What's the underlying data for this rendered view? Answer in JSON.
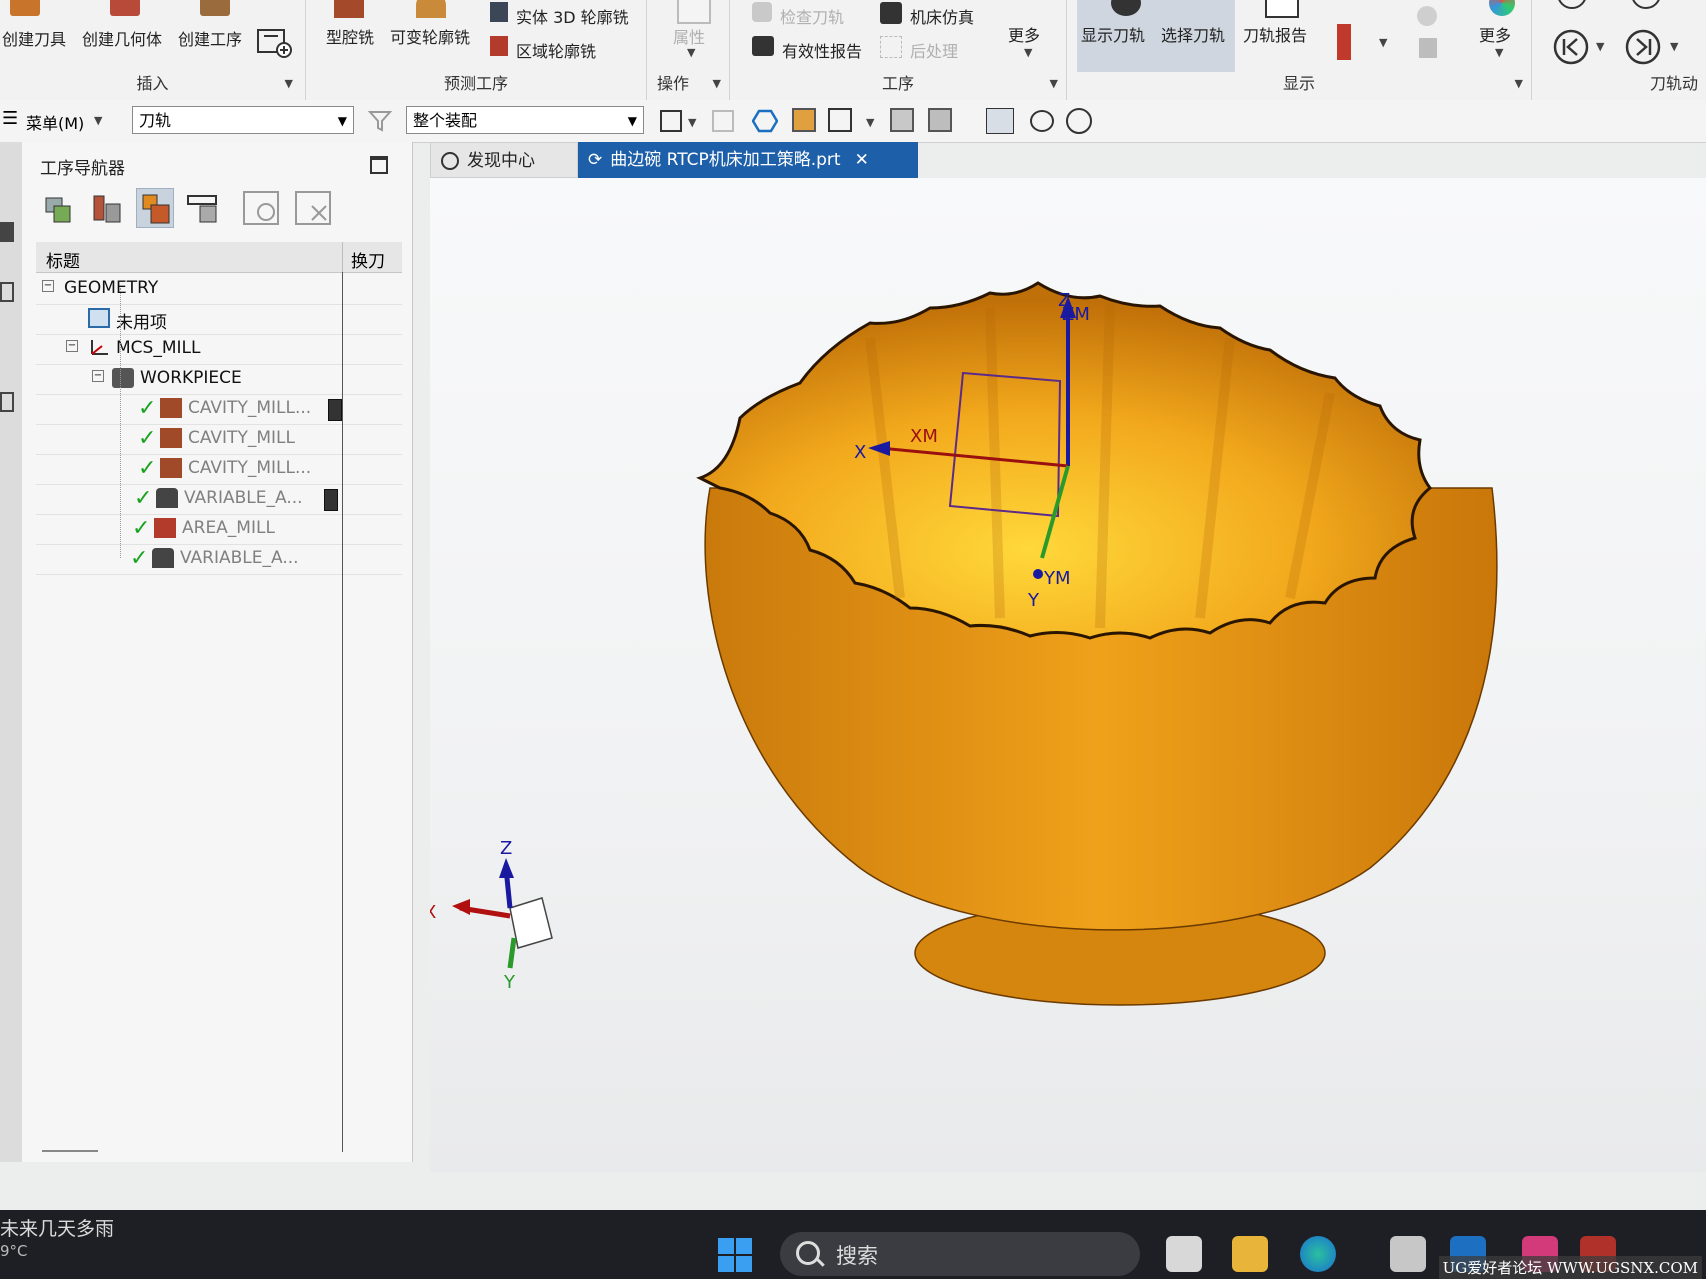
{
  "ribbon": {
    "insert_group": {
      "title": "插入",
      "buttons": [
        "创建刀具",
        "创建几何体",
        "创建工序"
      ]
    },
    "predefined_group": {
      "title": "预测工序",
      "buttons": [
        "型腔铣",
        "可变轮廓铣",
        "实体 3D 轮廓铣",
        "区域轮廓铣"
      ]
    },
    "operation_group": {
      "title": "操作",
      "buttons": [
        "属性"
      ]
    },
    "process_group": {
      "title": "工序",
      "buttons": [
        "检查刀轨",
        "机床仿真",
        "有效性报告",
        "后处理",
        "更多"
      ]
    },
    "display_group": {
      "title": "显示",
      "buttons": [
        "显示刀轨",
        "选择刀轨",
        "刀轨报告",
        "更多"
      ]
    },
    "toolpath_group": {
      "title": "刀轨动"
    }
  },
  "quickbar": {
    "menu_label": "菜单(M)",
    "filter_value": "刀轨",
    "scope_value": "整个装配"
  },
  "navigator": {
    "title": "工序导航器",
    "columns": [
      "标题",
      "换刀"
    ],
    "rows": [
      {
        "label": "GEOMETRY",
        "gray": false
      },
      {
        "label": "未用项",
        "gray": false
      },
      {
        "label": "MCS_MILL",
        "gray": false
      },
      {
        "label": "WORKPIECE",
        "gray": false
      },
      {
        "label": "CAVITY_MILL...",
        "gray": true,
        "check": true,
        "tool_change": true
      },
      {
        "label": "CAVITY_MILL",
        "gray": true,
        "check": true,
        "tool_change": false
      },
      {
        "label": "CAVITY_MILL...",
        "gray": true,
        "check": true,
        "tool_change": false
      },
      {
        "label": "VARIABLE_A...",
        "gray": true,
        "check": true,
        "tool_change": true
      },
      {
        "label": "AREA_MILL",
        "gray": true,
        "check": true,
        "tool_change": false
      },
      {
        "label": "VARIABLE_A...",
        "gray": true,
        "check": true,
        "tool_change": false
      }
    ]
  },
  "tabs": [
    {
      "label": "发现中心",
      "active": false
    },
    {
      "label": "曲边碗    RTCP机床加工策略.prt",
      "active": true,
      "close": "✕"
    }
  ],
  "viewport": {
    "mcs_labels": {
      "z": "Z",
      "zm": "ZM",
      "x": "X",
      "xm": "XM",
      "ym": "YM",
      "y": "Y"
    },
    "triad_labels": {
      "z": "Z",
      "x": "X",
      "y": "Y"
    },
    "part_color": "#e59a12"
  },
  "taskbar": {
    "weather_text": "未来几天多雨",
    "temperature": "9°C",
    "search_label": "搜索"
  },
  "watermark": "UG爱好者论坛 WWW.UGSNX.COM"
}
